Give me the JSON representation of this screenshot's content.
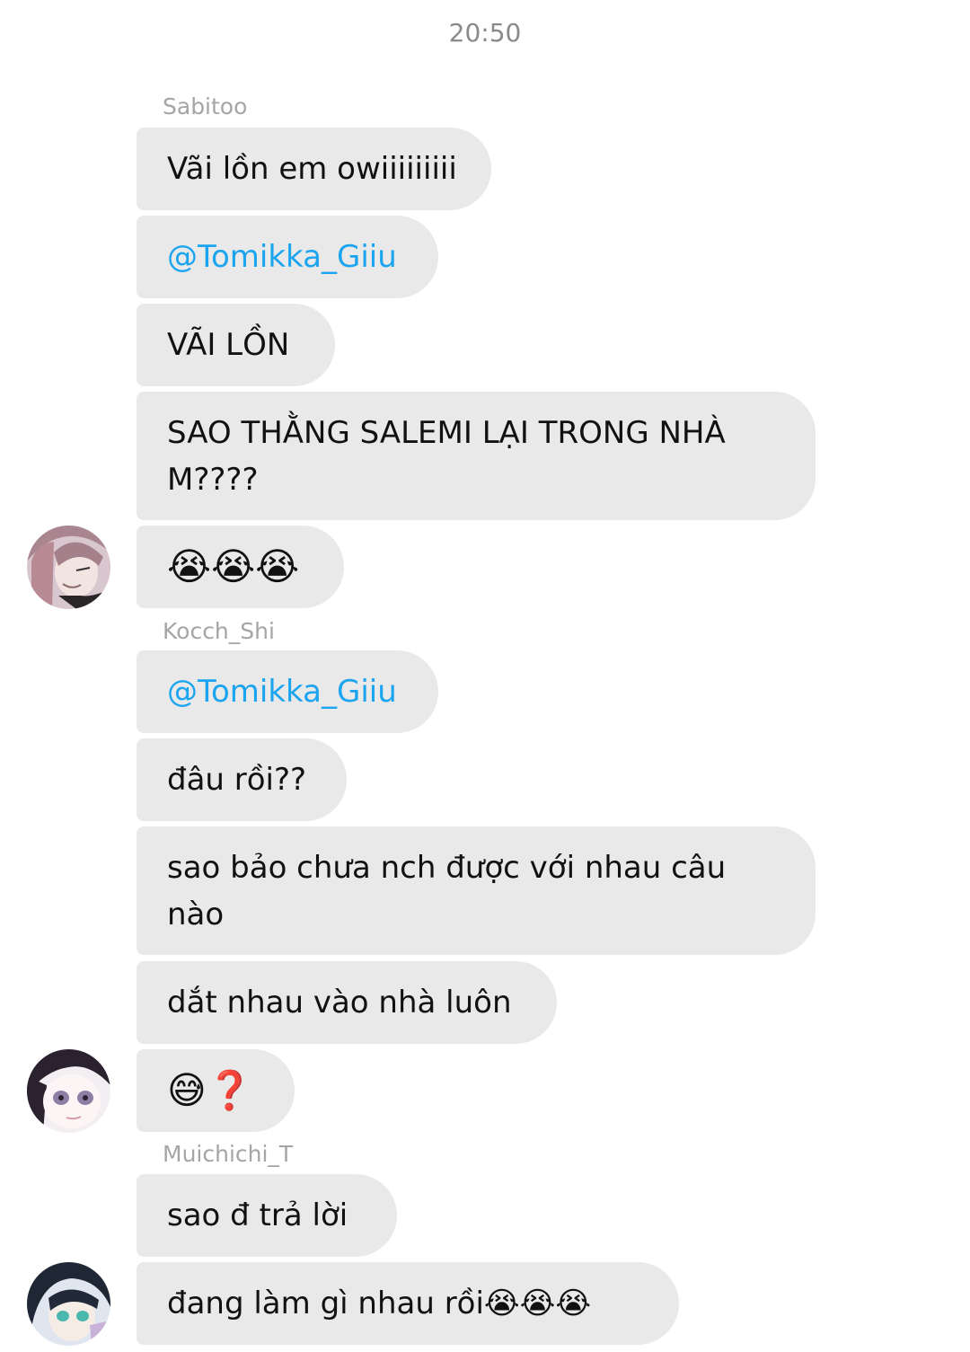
{
  "time": "20:50",
  "groups": [
    {
      "sender": "Sabitoo",
      "messages": [
        "Vãi lồn em owiiiiiiiii",
        "@Tomikka_Giiu",
        "VÃI LỒN",
        "SAO THẰNG SALEMI LẠI TRONG NHÀ M????",
        "😭😭😭"
      ]
    },
    {
      "sender": "Kocch_Shi",
      "messages": [
        "@Tomikka_Giiu",
        "đâu rồi??",
        "sao bảo chưa nch được với nhau câu nào",
        "dắt nhau vào nhà luôn",
        "😅❓"
      ]
    },
    {
      "sender": "Muichichi_T",
      "messages": [
        "sao đ trả lời",
        "đang làm gì nhau rồi😭😭😭"
      ]
    }
  ],
  "colors": {
    "bubble": "#e9e9e9",
    "mention": "#1ba4ef",
    "text": "#111111",
    "sender": "#a5a5a5"
  },
  "avatars": [
    "sabitoo-avatar",
    "kocch-shi-avatar",
    "muichichi-avatar"
  ]
}
